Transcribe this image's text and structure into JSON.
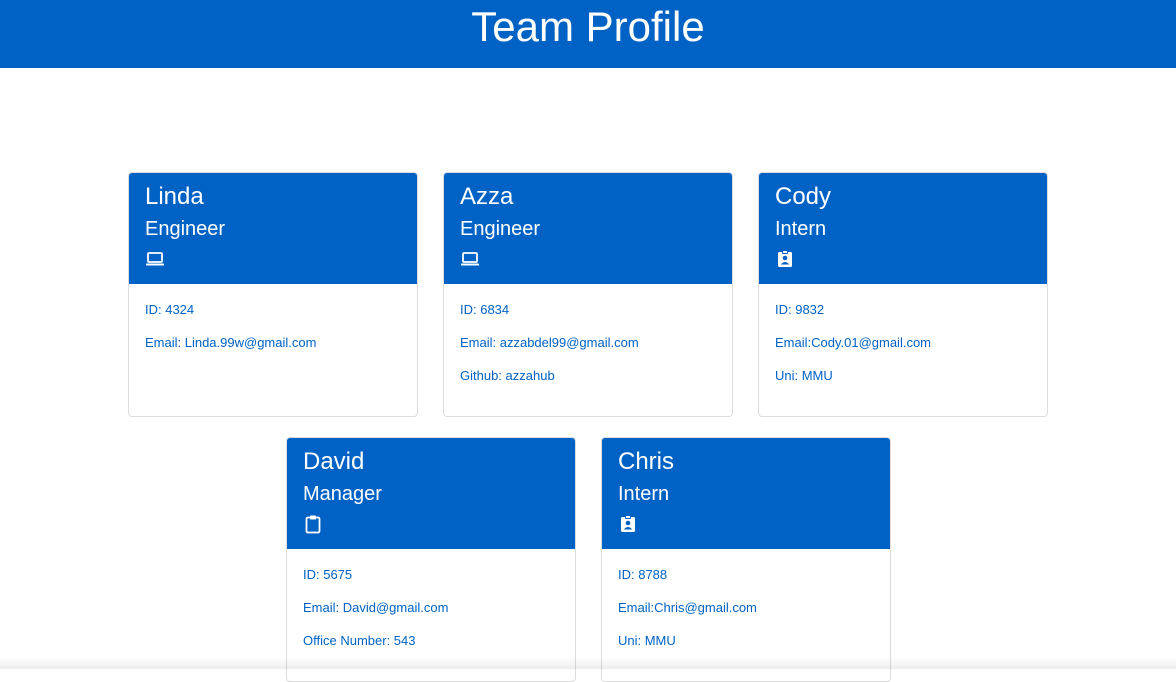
{
  "header": {
    "title": "Team Profile"
  },
  "employees": [
    {
      "name": "Linda",
      "role": "Engineer",
      "icon": "laptop-icon",
      "lines": [
        "ID: 4324",
        "Email: Linda.99w@gmail.com"
      ]
    },
    {
      "name": "Azza",
      "role": "Engineer",
      "icon": "laptop-icon",
      "lines": [
        "ID: 6834",
        "Email: azzabdel99@gmail.com",
        "Github: azzahub"
      ]
    },
    {
      "name": "Cody",
      "role": "Intern",
      "icon": "id-badge-icon",
      "lines": [
        "ID: 9832",
        "Email:Cody.01@gmail.com",
        "Uni: MMU"
      ]
    },
    {
      "name": "David",
      "role": "Manager",
      "icon": "clipboard-icon",
      "lines": [
        "ID: 5675",
        "Email: David@gmail.com",
        "Office Number: 543"
      ]
    },
    {
      "name": "Chris",
      "role": "Intern",
      "icon": "id-badge-icon",
      "lines": [
        "ID: 8788",
        "Email:Chris@gmail.com",
        "Uni: MMU"
      ]
    }
  ],
  "colors": {
    "primary": "#0062c4",
    "background": "#ffffff",
    "text_on_primary": "#ffffff"
  }
}
